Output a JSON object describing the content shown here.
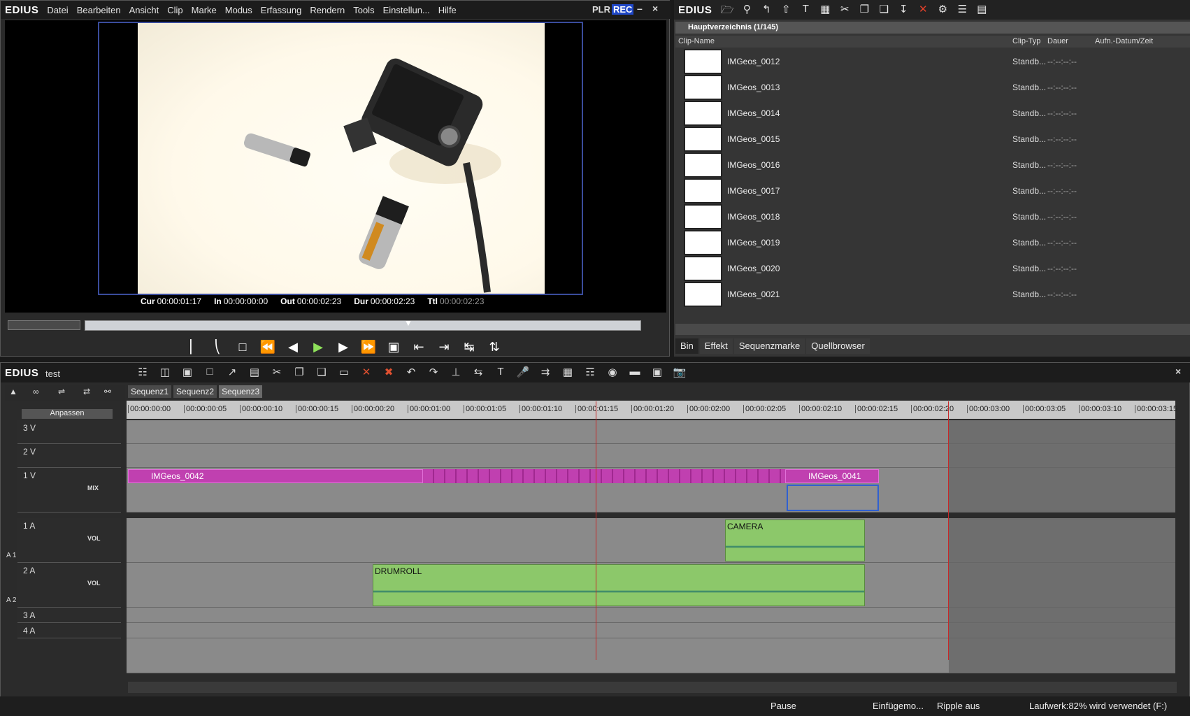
{
  "app": {
    "logo": "EDIUS",
    "project": "test"
  },
  "menu": [
    "Datei",
    "Bearbeiten",
    "Ansicht",
    "Clip",
    "Marke",
    "Modus",
    "Erfassung",
    "Rendern",
    "Tools",
    "Einstellun...",
    "Hilfe"
  ],
  "player": {
    "plr": "PLR",
    "rec": "REC",
    "timecodes": [
      {
        "label": "Cur",
        "value": "00:00:01:17"
      },
      {
        "label": "In",
        "value": "00:00:00:00"
      },
      {
        "label": "Out",
        "value": "00:00:02:23"
      },
      {
        "label": "Dur",
        "value": "00:00:02:23"
      },
      {
        "label": "Ttl",
        "value": "00:00:02:23"
      }
    ]
  },
  "bin": {
    "logo": "EDIUS",
    "folder": "Hauptverzeichnis (1/145)",
    "columns": [
      "Clip-Name",
      "Clip-Typ",
      "Dauer",
      "Aufn.-Datum/Zeit"
    ],
    "rows": [
      {
        "name": "IMGeos_0012",
        "type": "Standb...",
        "dur": "--:--:--:--"
      },
      {
        "name": "IMGeos_0013",
        "type": "Standb...",
        "dur": "--:--:--:--"
      },
      {
        "name": "IMGeos_0014",
        "type": "Standb...",
        "dur": "--:--:--:--"
      },
      {
        "name": "IMGeos_0015",
        "type": "Standb...",
        "dur": "--:--:--:--"
      },
      {
        "name": "IMGeos_0016",
        "type": "Standb...",
        "dur": "--:--:--:--"
      },
      {
        "name": "IMGeos_0017",
        "type": "Standb...",
        "dur": "--:--:--:--"
      },
      {
        "name": "IMGeos_0018",
        "type": "Standb...",
        "dur": "--:--:--:--"
      },
      {
        "name": "IMGeos_0019",
        "type": "Standb...",
        "dur": "--:--:--:--"
      },
      {
        "name": "IMGeos_0020",
        "type": "Standb...",
        "dur": "--:--:--:--"
      },
      {
        "name": "IMGeos_0021",
        "type": "Standb...",
        "dur": "--:--:--:--"
      }
    ],
    "tabs": [
      "Bin",
      "Effekt",
      "Sequenzmarke",
      "Quellbrowser"
    ]
  },
  "timeline": {
    "sequences": [
      "Sequenz1",
      "Sequenz2",
      "Sequenz3"
    ],
    "fit_label": "Anpassen",
    "ruler": [
      "00:00:00:00",
      "00:00:00:05",
      "00:00:00:10",
      "00:00:00:15",
      "00:00:00:20",
      "00:00:01:00",
      "00:00:01:05",
      "00:00:01:10",
      "00:00:01:15",
      "00:00:01:20",
      "00:00:02:00",
      "00:00:02:05",
      "00:00:02:10",
      "00:00:02:15",
      "00:00:02:20",
      "00:00:03:00",
      "00:00:03:05",
      "00:00:03:10",
      "00:00:03:15"
    ],
    "tracks": {
      "v3": "3 V",
      "v2": "2 V",
      "v1": "1 V",
      "mix": "MIX",
      "a1": "1 A",
      "a2": "2 A",
      "a3": "3 A",
      "a4": "4 A",
      "vol": "VOL",
      "a1_side": "A 1",
      "a2_side": "A 2"
    },
    "clips": {
      "video1": "IMGeos_0042",
      "video2": "IMGeos_0041",
      "audio1": "CAMERA",
      "audio2": "DRUMROLL"
    }
  },
  "status": {
    "pause": "Pause",
    "insert": "Einfügemo...",
    "ripple": "Ripple aus",
    "drive": "Laufwerk:82% wird verwendet (F:)"
  }
}
